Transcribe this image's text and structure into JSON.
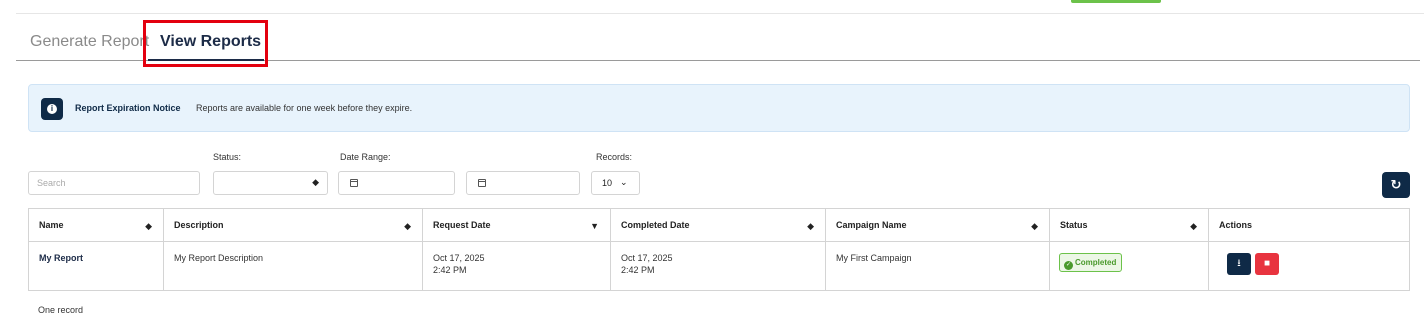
{
  "tabs": {
    "generate_label": "Generate Report",
    "view_label": "View Reports"
  },
  "notice": {
    "icon": "info-icon",
    "title": "Report Expiration Notice",
    "text": "Reports are available for one week before they expire."
  },
  "filters": {
    "search_placeholder": "Search",
    "status_label": "Status:",
    "status_value": "",
    "date_range_label": "Date Range:",
    "records_label": "Records:",
    "records_value": "10"
  },
  "table": {
    "columns": [
      "Name",
      "Description",
      "Request Date",
      "Completed Date",
      "Campaign Name",
      "Status",
      "Actions"
    ],
    "rows": [
      {
        "name": "My Report",
        "description": "My Report Description",
        "request_date": "Oct 17, 2025",
        "request_time": "2:42 PM",
        "completed_date": "Oct 17, 2025",
        "completed_time": "2:42 PM",
        "campaign": "My First Campaign",
        "status": "Completed"
      }
    ]
  },
  "footer": {
    "record_count": "One record"
  },
  "colors": {
    "navy": "#0f2a47",
    "danger": "#e8343f",
    "success": "#6cc24a",
    "notice_bg": "#e8f3fc",
    "highlight": "#e3000f"
  }
}
